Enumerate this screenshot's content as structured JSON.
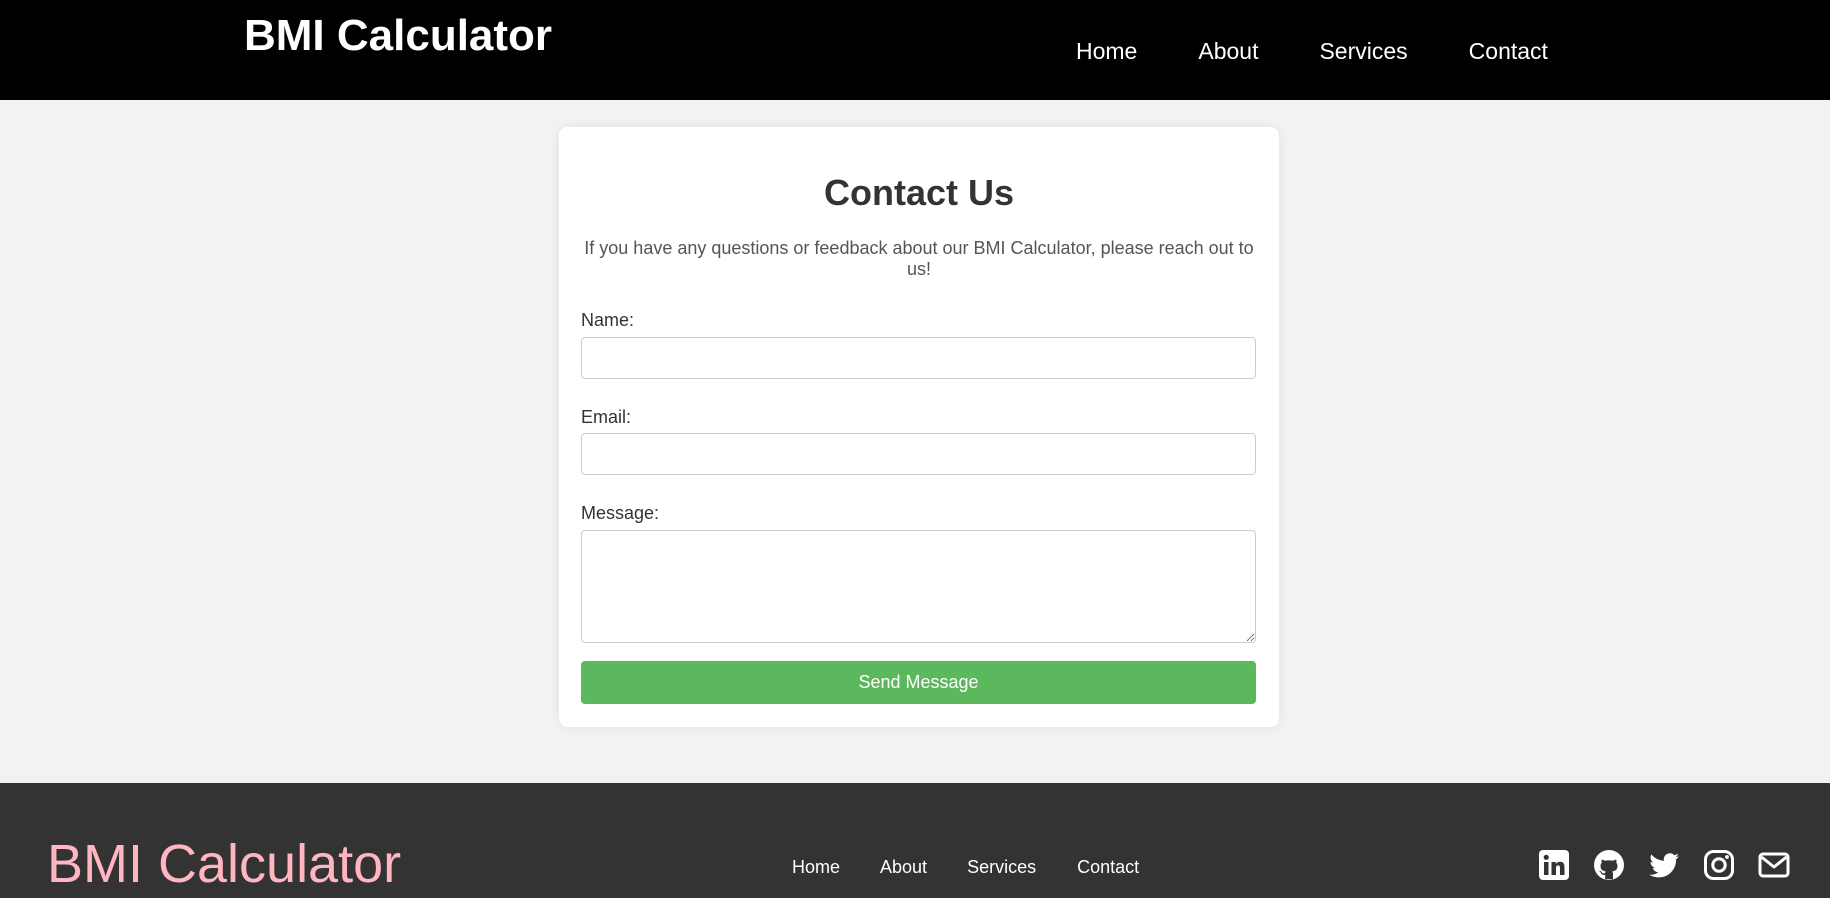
{
  "header": {
    "title": "BMI Calculator",
    "nav": [
      {
        "label": "Home"
      },
      {
        "label": "About"
      },
      {
        "label": "Services"
      },
      {
        "label": "Contact"
      }
    ]
  },
  "contact": {
    "heading": "Contact Us",
    "intro": "If you have any questions or feedback about our BMI Calculator, please reach out to us!",
    "name_label": "Name:",
    "name_value": "",
    "email_label": "Email:",
    "email_value": "",
    "message_label": "Message:",
    "message_value": "",
    "submit_label": "Send Message"
  },
  "footer": {
    "title": "BMI Calculator",
    "nav": [
      {
        "label": "Home"
      },
      {
        "label": "About"
      },
      {
        "label": "Services"
      },
      {
        "label": "Contact"
      }
    ],
    "social_icons": [
      "linkedin-icon",
      "github-icon",
      "twitter-icon",
      "instagram-icon",
      "mail-icon"
    ]
  },
  "colors": {
    "header_bg": "#000000",
    "page_bg": "#f2f2f2",
    "card_bg": "#ffffff",
    "button_bg": "#5cb85c",
    "footer_bg": "#333333",
    "footer_title": "#ffb6c1"
  }
}
